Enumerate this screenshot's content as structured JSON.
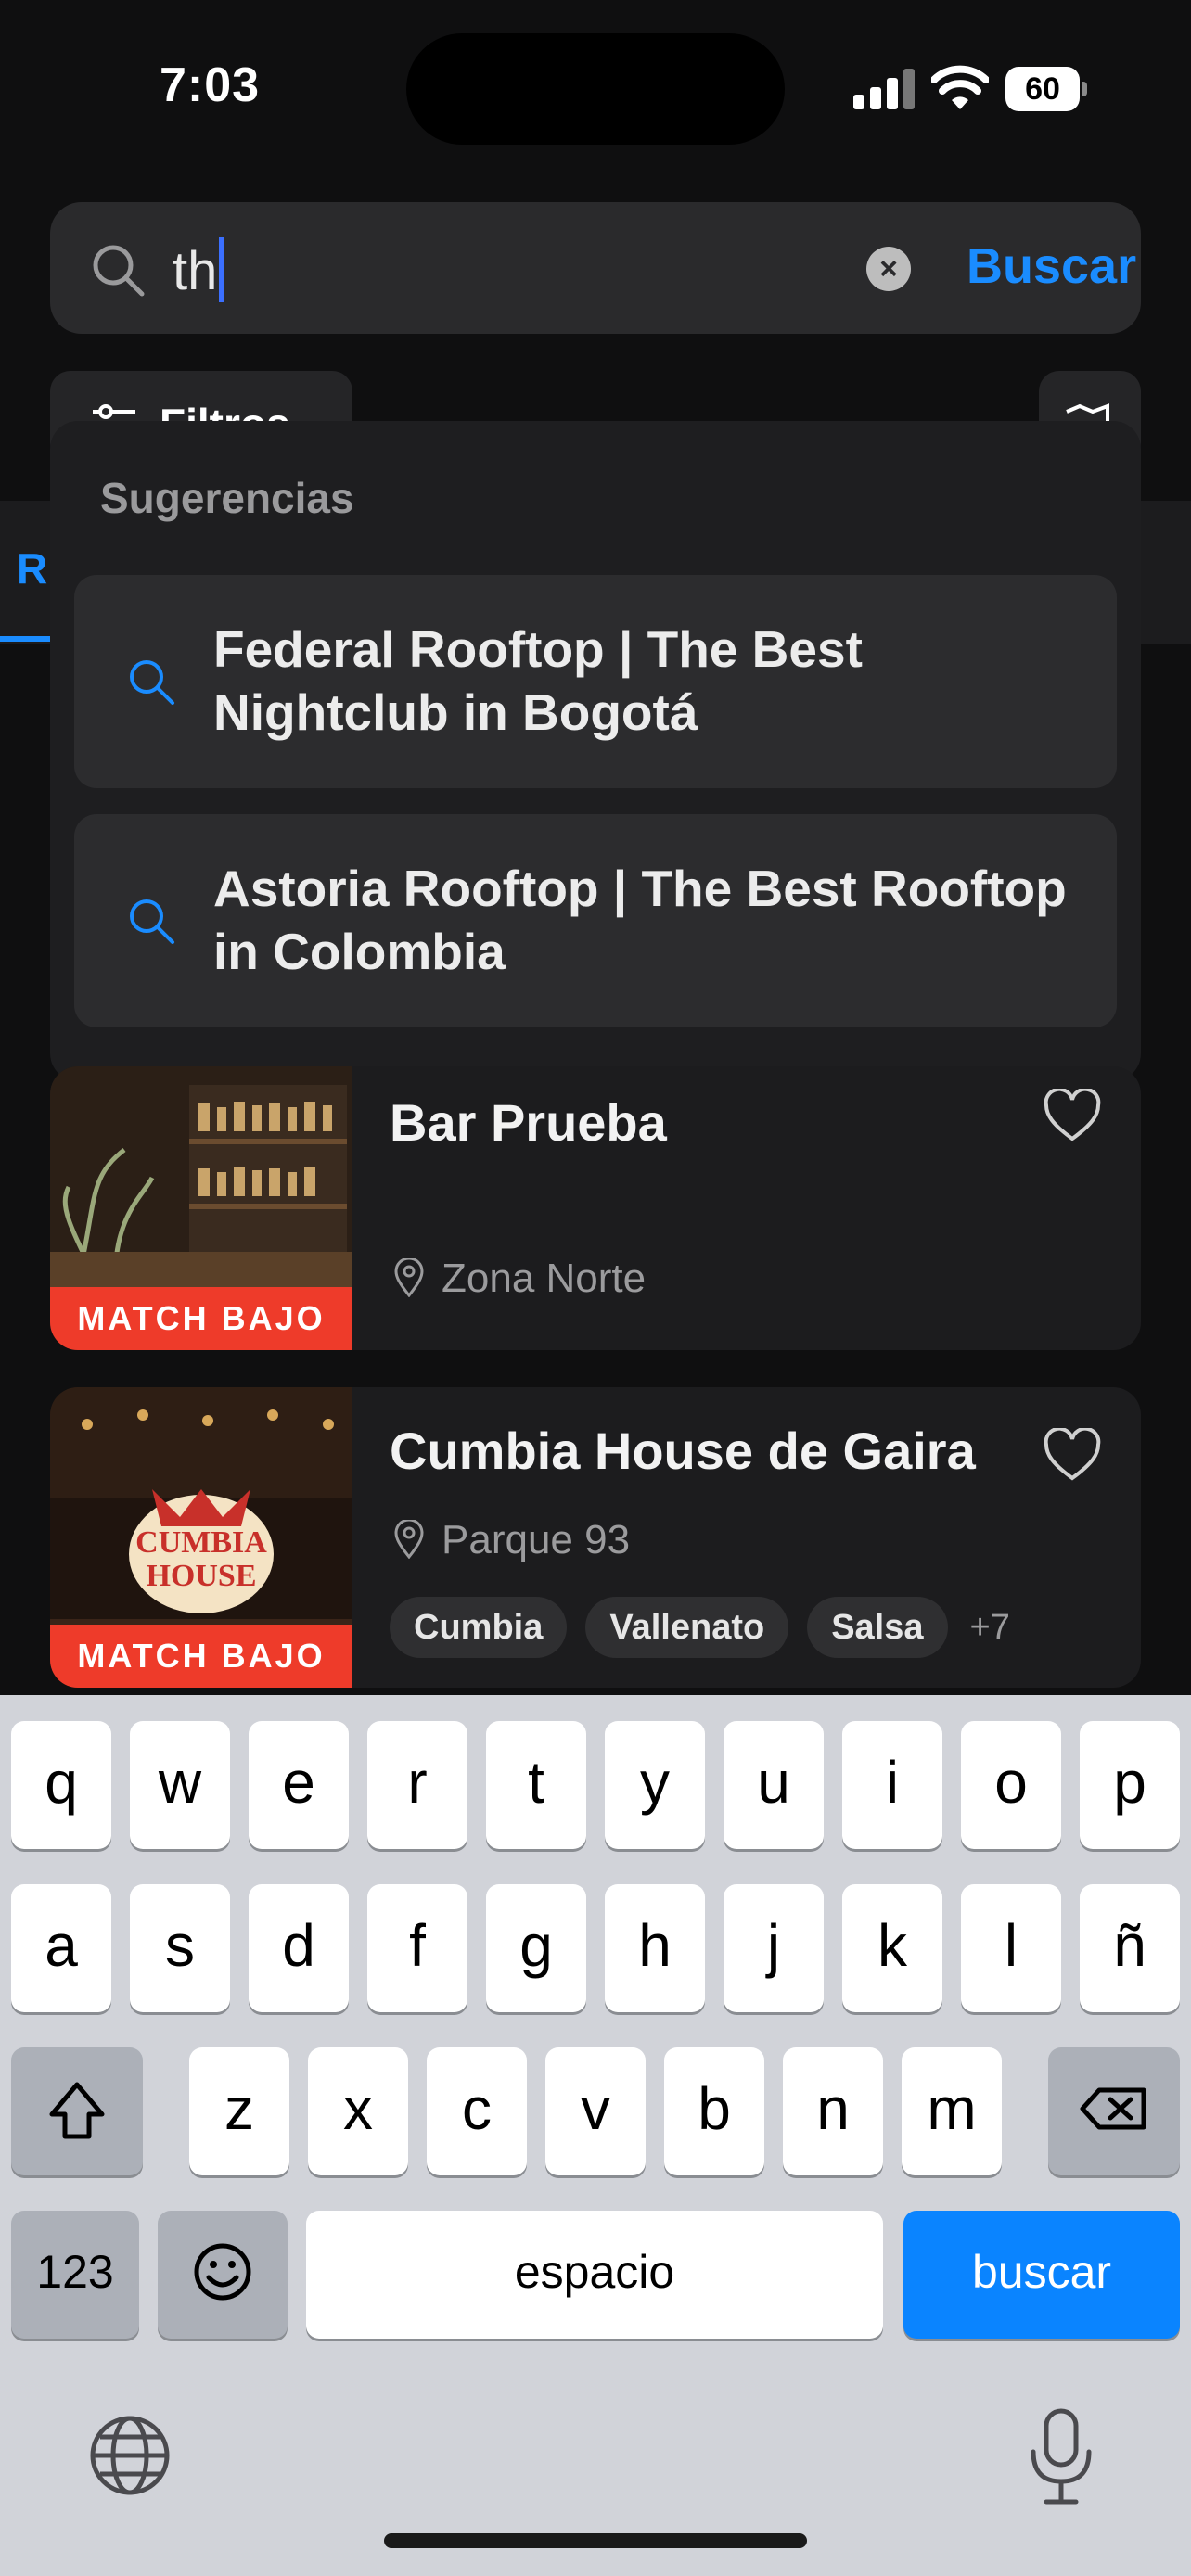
{
  "status_bar": {
    "time": "7:03",
    "battery": "60"
  },
  "search": {
    "value": "th",
    "action_label": "Buscar"
  },
  "filters": {
    "label": "Filtros"
  },
  "tab_partial": "R",
  "suggestions": {
    "title": "Sugerencias",
    "items": [
      {
        "label": "Federal Rooftop | The Best Nightclub in Bogotá"
      },
      {
        "label": "Astoria Rooftop | The Best Rooftop in Colombia"
      }
    ]
  },
  "results": [
    {
      "name": "Bar Prueba",
      "location": "Zona Norte",
      "badge": "MATCH BAJO",
      "tags": [],
      "more": ""
    },
    {
      "name": "Cumbia House de Gaira",
      "location": "Parque 93",
      "badge": "MATCH BAJO",
      "tags": [
        "Cumbia",
        "Vallenato",
        "Salsa"
      ],
      "more": "+7",
      "logo_text": [
        "CUMBIA",
        "HOUSE"
      ]
    }
  ],
  "keyboard": {
    "row1": [
      "q",
      "w",
      "e",
      "r",
      "t",
      "y",
      "u",
      "i",
      "o",
      "p"
    ],
    "row2": [
      "a",
      "s",
      "d",
      "f",
      "g",
      "h",
      "j",
      "k",
      "l",
      "ñ"
    ],
    "row3": [
      "z",
      "x",
      "c",
      "v",
      "b",
      "n",
      "m"
    ],
    "numbers_label": "123",
    "space_label": "espacio",
    "action_label": "buscar"
  },
  "icons": {
    "search": "magnifier-icon",
    "clear": "clear-x-icon",
    "filter": "sliders-icon",
    "map": "map-icon",
    "heart": "heart-outline-icon",
    "pin": "location-pin-icon",
    "shift": "shift-arrow-icon",
    "delete": "backspace-icon",
    "emoji": "emoji-icon",
    "globe": "globe-icon",
    "mic": "microphone-icon"
  },
  "colors": {
    "accent": "#1a8cff",
    "badge": "#ee3b2a",
    "background": "#0f0f10",
    "card": "#1c1c1e"
  }
}
